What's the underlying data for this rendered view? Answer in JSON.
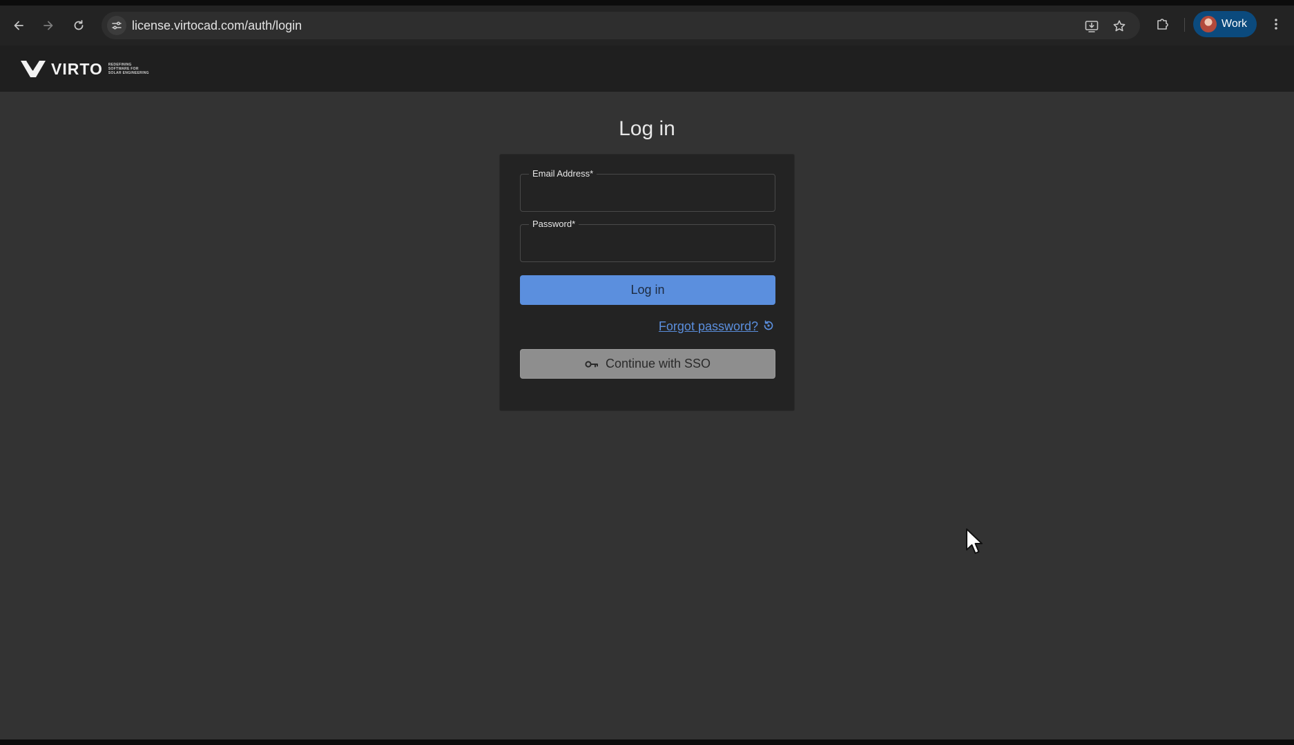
{
  "browser": {
    "url": "license.virtocad.com/auth/login",
    "profile_label": "Work"
  },
  "site": {
    "brand_name": "VIRTO",
    "brand_tagline": "REDEFINING SOFTWARE FOR SOLAR ENGINEERING"
  },
  "login": {
    "title": "Log in",
    "email_label": "Email Address",
    "email_required_mark": "*",
    "email_value": "",
    "password_label": "Password",
    "password_required_mark": "*",
    "password_value": "",
    "submit_label": "Log in",
    "forgot_label": "Forgot password?",
    "sso_label": "Continue with SSO"
  },
  "colors": {
    "page_background": "#333333",
    "card_background": "#232323",
    "primary_button": "#5b8fde",
    "sso_button": "#8e8e8e",
    "link": "#5b8fde",
    "profile_chip": "#0b4a7d"
  },
  "icons": {
    "back": "arrow-left-icon",
    "forward": "arrow-right-icon",
    "reload": "reload-icon",
    "site_info": "tune-icon",
    "install": "install-app-icon",
    "bookmark": "star-icon",
    "extensions": "puzzle-icon",
    "menu": "kebab-menu-icon",
    "forgot": "reset-icon",
    "sso": "key-icon"
  }
}
